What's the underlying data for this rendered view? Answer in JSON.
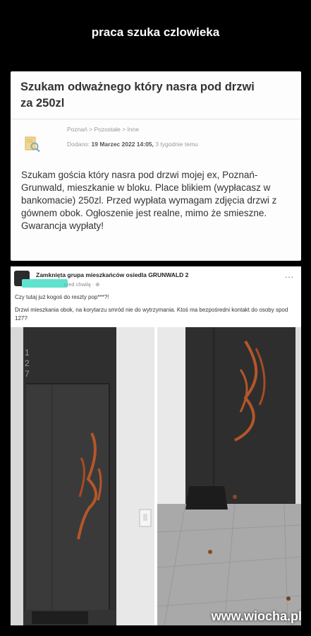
{
  "meme": {
    "title": "praca szuka czlowieka"
  },
  "ad": {
    "title_line1": "Szukam odważnego który nasra pod drzwi",
    "title_line2": "za 250zl",
    "breadcrumb": "Poznań > Pozostałe > Inne",
    "date_label": "Dodano:",
    "date_value": "19 Marzec 2022 14:05,",
    "date_ago": "3 tygodnie temu",
    "body": "Szukam gościa który nasra pod drzwi mojej ex, Poznań-Grunwald, mieszkanie w bloku. Place blikiem (wypłacasz w bankomacie) 250zl. Przed wypłata wymagam zdjęcia drzwi z gównem obok. Ogłoszenie jest realne, mimo że smieszne. Gwarancja wypłaty!"
  },
  "post": {
    "group": "Zamknięta grupa mieszkańców osiedla GRUNWALD 2",
    "time": "rzed chwilą · ⊕",
    "more": "...",
    "line1": "Czy tutaj już kogoś do reszty pop***?!",
    "line2": "Drzwi mieszkania obok, na korytarzu smród nie do wytrzymania. Ktoś ma bezpośredni kontakt do osoby spod 127?"
  },
  "watermark": "www.wiocha.pl",
  "colors": {
    "background": "#000000",
    "redaction": "#5fe3cf",
    "door": "#3a3a3a",
    "stain": "#b4562a"
  }
}
